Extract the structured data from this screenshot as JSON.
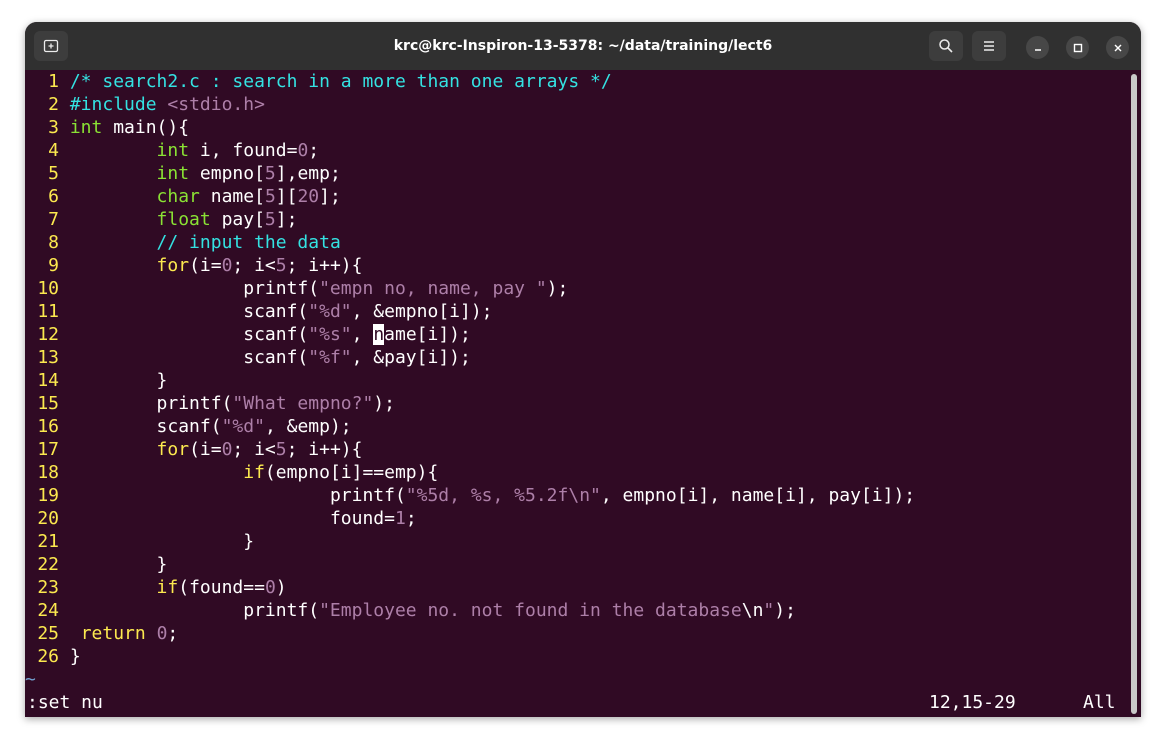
{
  "window": {
    "title": "krc@krc-Inspiron-13-5378: ~/data/training/lect6"
  },
  "titlebar": {
    "new_tab_icon": "new-tab-icon",
    "search_icon": "search-icon",
    "menu_icon": "hamburger-menu-icon",
    "minimize_icon": "minimize-icon",
    "maximize_icon": "maximize-icon",
    "close_icon": "close-icon"
  },
  "editor": {
    "line_numbers": [
      "1",
      "2",
      "3",
      "4",
      "5",
      "6",
      "7",
      "8",
      "9",
      "10",
      "11",
      "12",
      "13",
      "14",
      "15",
      "16",
      "17",
      "18",
      "19",
      "20",
      "21",
      "22",
      "23",
      "24",
      "25",
      "26"
    ],
    "tilde": "~",
    "command_line": ":set nu",
    "cursor_position": "12,15-29",
    "scroll_position": "All",
    "code": {
      "l1": "/* search2.c : search in a more than one arrays */",
      "l2_directive": "#include",
      "l2_header": "<stdio.h>",
      "l3_type": "int",
      "l3_rest": " main(){",
      "l4_type": "int",
      "l4_a": " i, found=",
      "l4_num": "0",
      "l4_b": ";",
      "l5_type": "int",
      "l5_a": " empno[",
      "l5_num": "5",
      "l5_b": "],emp;",
      "l6_type": "char",
      "l6_a": " name[",
      "l6_num1": "5",
      "l6_b": "][",
      "l6_num2": "20",
      "l6_c": "];",
      "l7_type": "float",
      "l7_a": " pay[",
      "l7_num": "5",
      "l7_b": "];",
      "l8": "// input the data",
      "l9_kw": "for",
      "l9_a": "(i=",
      "l9_num1": "0",
      "l9_b": "; i<",
      "l9_num2": "5",
      "l9_c": "; i++){",
      "l10_a": "printf(",
      "l10_str": "\"empn no, name, pay \"",
      "l10_b": ");",
      "l11_a": "scanf(",
      "l11_str": "\"%d\"",
      "l11_b": ", &empno[i]);",
      "l12_a": "scanf(",
      "l12_str": "\"%s\"",
      "l12_b": ", ",
      "l12_cursor": "n",
      "l12_c": "ame[i]);",
      "l13_a": "scanf(",
      "l13_str": "\"%f\"",
      "l13_b": ", &pay[i]);",
      "l14": "}",
      "l15_a": "printf(",
      "l15_str": "\"What empno?\"",
      "l15_b": ");",
      "l16_a": "scanf(",
      "l16_str": "\"%d\"",
      "l16_b": ", &emp);",
      "l17_kw": "for",
      "l17_a": "(i=",
      "l17_num1": "0",
      "l17_b": "; i<",
      "l17_num2": "5",
      "l17_c": "; i++){",
      "l18_kw": "if",
      "l18_a": "(empno[i]==emp){",
      "l19_a": "printf(",
      "l19_str": "\"%5d, %s, %5.2f\\n\"",
      "l19_b": ", empno[i], name[i], pay[i]);",
      "l20_a": "found=",
      "l20_num": "1",
      "l20_b": ";",
      "l21": "}",
      "l22": "}",
      "l23_kw": "if",
      "l23_a": "(found==",
      "l23_num": "0",
      "l23_b": ")",
      "l24_a": "printf(",
      "l24_str1": "\"Employee no. not found in the database",
      "l24_esc": "\\n",
      "l24_str2": "\"",
      "l24_b": ");",
      "l25_kw": "return",
      "l25_sp": " ",
      "l25_num": "0",
      "l25_b": ";",
      "l26": "}"
    }
  },
  "colors": {
    "background": "#300a24",
    "titlebar": "#303030",
    "line_number": "#fce94f",
    "keyword": "#fce94f",
    "type": "#8ae234",
    "string": "#ad7fa8",
    "comment": "#34e2e2"
  }
}
